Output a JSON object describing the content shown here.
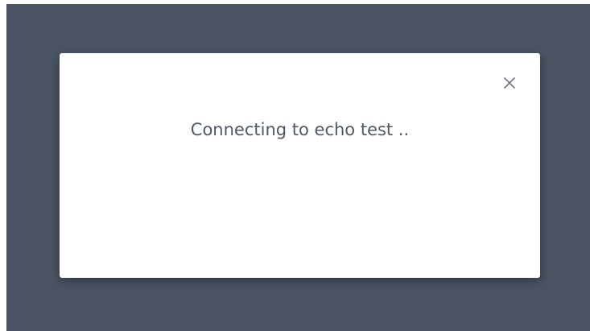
{
  "modal": {
    "message": "Connecting to echo test ..",
    "close_icon": "close-icon"
  },
  "colors": {
    "backdrop": "#4a5463",
    "modal_background": "#ffffff",
    "text": "#4f5966",
    "close_icon": "#6b7480"
  }
}
